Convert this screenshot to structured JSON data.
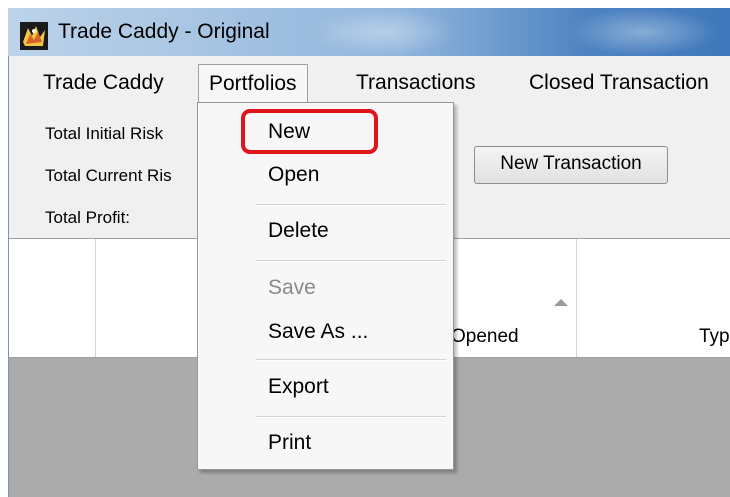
{
  "window": {
    "title": "Trade Caddy - Original",
    "icon": "app-logo-icon"
  },
  "menubar": {
    "items": [
      {
        "label": "Trade Caddy"
      },
      {
        "label": "Portfolios",
        "open": true
      },
      {
        "label": "Transactions"
      },
      {
        "label": "Closed Transaction"
      }
    ]
  },
  "summary": {
    "initial_risk": "Total Initial  Risk",
    "current_risk": "Total Current Ris",
    "profit": "Total Profit:"
  },
  "toolbar": {
    "new_transaction": "New Transaction"
  },
  "grid": {
    "columns": [
      "Opened",
      "Typ"
    ],
    "sorted_column": "Opened",
    "sort_direction": "ascending"
  },
  "portfolios_menu": {
    "items": [
      {
        "label": "New",
        "enabled": true,
        "highlighted": true
      },
      {
        "label": "Open",
        "enabled": true
      },
      {
        "label": "Delete",
        "enabled": true
      },
      {
        "label": "Save",
        "enabled": false
      },
      {
        "label": "Save As ...",
        "enabled": true
      },
      {
        "label": "Export",
        "enabled": true
      },
      {
        "label": "Print",
        "enabled": true
      }
    ]
  },
  "colors": {
    "highlight_ring": "#e0141b",
    "title_bar": "#4f84c2",
    "grid_background": "#ababab"
  }
}
